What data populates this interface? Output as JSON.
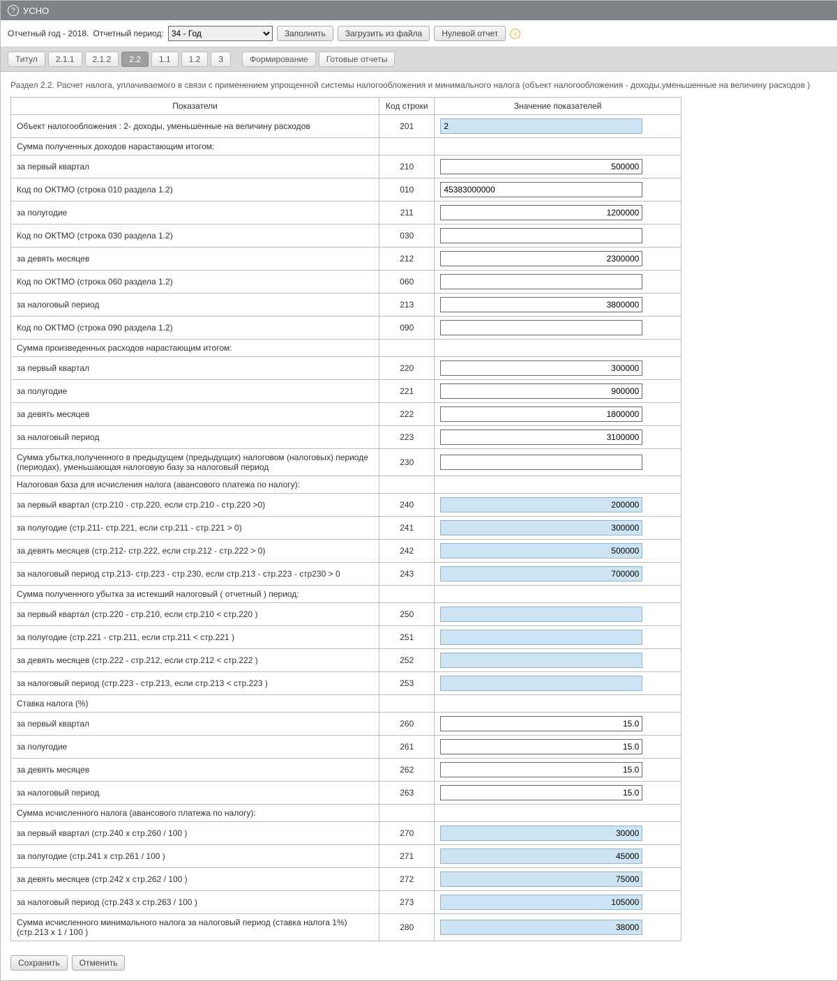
{
  "titlebar": {
    "title": "УСНО"
  },
  "toolbar": {
    "year_label": "Отчетный год - 2018.",
    "period_label": "Отчетный период:",
    "period_value": "34 - Год",
    "fill": "Заполнить",
    "load_file": "Загрузить из файла",
    "zero_report": "Нулевой отчет"
  },
  "tabs": {
    "titul": "Титул",
    "t211": "2.1.1",
    "t212": "2.1.2",
    "t22": "2.2",
    "t11": "1.1",
    "t12": "1.2",
    "t3": "3",
    "form": "Формирование",
    "ready": "Готовые отчеты"
  },
  "section_title": "Раздел 2.2. Расчет налога, уплачиваемого в связи с применением упрощенной системы налогообложения и минимального налога (объект налогообложения - доходы,уменьшенные на величину расходов )",
  "headers": {
    "ind": "Показатели",
    "code": "Код строки",
    "val": "Значение показателей"
  },
  "rows": [
    {
      "label": "Объект налогообложения : 2- доходы, уменьшенные на величину расходов",
      "code": "201",
      "value": "2",
      "align": "left",
      "readonly": true
    },
    {
      "label": "Сумма полученных доходов нарастающим итогом:",
      "code": "",
      "value": null
    },
    {
      "label": "за первый квартал",
      "code": "210",
      "value": "500000",
      "align": "right",
      "readonly": false
    },
    {
      "label": "Код по ОКТМО (строка 010 раздела 1.2)",
      "code": "010",
      "value": "45383000000",
      "align": "left",
      "readonly": false
    },
    {
      "label": "за полугодие",
      "code": "211",
      "value": "1200000",
      "align": "right",
      "readonly": false
    },
    {
      "label": "Код по ОКТМО (строка 030 раздела 1.2)",
      "code": "030",
      "value": "",
      "align": "left",
      "readonly": false
    },
    {
      "label": "за девять месяцев",
      "code": "212",
      "value": "2300000",
      "align": "right",
      "readonly": false
    },
    {
      "label": "Код по ОКТМО (строка 060 раздела 1.2)",
      "code": "060",
      "value": "",
      "align": "left",
      "readonly": false
    },
    {
      "label": "за налоговый период",
      "code": "213",
      "value": "3800000",
      "align": "right",
      "readonly": false
    },
    {
      "label": "Код по ОКТМО (строка 090 раздела 1.2)",
      "code": "090",
      "value": "",
      "align": "left",
      "readonly": false
    },
    {
      "label": "Сумма произведенных расходов нарастающим итогом:",
      "code": "",
      "value": null
    },
    {
      "label": "за первый квартал",
      "code": "220",
      "value": "300000",
      "align": "right",
      "readonly": false
    },
    {
      "label": "за полугодие",
      "code": "221",
      "value": "900000",
      "align": "right",
      "readonly": false
    },
    {
      "label": "за девять месяцев",
      "code": "222",
      "value": "1800000",
      "align": "right",
      "readonly": false
    },
    {
      "label": "за налоговый период",
      "code": "223",
      "value": "3100000",
      "align": "right",
      "readonly": false
    },
    {
      "label": "Сумма убытка,полученного в предыдущем (предыдущих) налоговом (налоговых) периоде (периодах), уменьшающая налоговую базу за налоговый период",
      "code": "230",
      "value": "",
      "align": "left",
      "readonly": false
    },
    {
      "label": "Налоговая база для исчисления налога (авансового платежа по налогу):",
      "code": "",
      "value": null
    },
    {
      "label": "за первый квартал (стр.210 - стр.220, если стр.210 - стр.220 >0)",
      "code": "240",
      "value": "200000",
      "align": "right",
      "readonly": true
    },
    {
      "label": "за полугодие (стр.211- стр.221, если стр.211 - стр.221 > 0)",
      "code": "241",
      "value": "300000",
      "align": "right",
      "readonly": true
    },
    {
      "label": "за девять месяцев (стр.212- стр.222, если стр.212 - стр.222 > 0)",
      "code": "242",
      "value": "500000",
      "align": "right",
      "readonly": true
    },
    {
      "label": "за налоговый период стр.213- стр.223 - стр.230, если стр.213 - стр.223 - стр230 > 0",
      "code": "243",
      "value": "700000",
      "align": "right",
      "readonly": true
    },
    {
      "label": "Сумма полученного убытка за истекший налоговый ( отчетный ) период:",
      "code": "",
      "value": null
    },
    {
      "label": "за первый квартал (стр.220 - стр.210, если стр.210 < стр.220 )",
      "code": "250",
      "value": "",
      "align": "right",
      "readonly": true
    },
    {
      "label": "за полугодие (стр.221 - стр.211, если стр.211 < стр.221 )",
      "code": "251",
      "value": "",
      "align": "right",
      "readonly": true
    },
    {
      "label": "за девять месяцев (стр.222 - стр.212, если стр.212 < стр.222 )",
      "code": "252",
      "value": "",
      "align": "right",
      "readonly": true
    },
    {
      "label": "за налоговый период (стр.223 - стр.213, если стр.213 < стр.223 )",
      "code": "253",
      "value": "",
      "align": "right",
      "readonly": true
    },
    {
      "label": "Ставка налога (%)",
      "code": "",
      "value": null
    },
    {
      "label": "за первый квартал",
      "code": "260",
      "value": "15.0",
      "align": "right",
      "readonly": false
    },
    {
      "label": "за полугодие",
      "code": "261",
      "value": "15.0",
      "align": "right",
      "readonly": false
    },
    {
      "label": "за девять месяцев",
      "code": "262",
      "value": "15.0",
      "align": "right",
      "readonly": false
    },
    {
      "label": "за налоговый период",
      "code": "263",
      "value": "15.0",
      "align": "right",
      "readonly": false
    },
    {
      "label": "Сумма исчисленного налога (авансового платежа по налогу):",
      "code": "",
      "value": null
    },
    {
      "label": "за первый квартал (стр.240 x стр.260 / 100 )",
      "code": "270",
      "value": "30000",
      "align": "right",
      "readonly": true
    },
    {
      "label": "за полугодие (стр.241 x стр.261 / 100 )",
      "code": "271",
      "value": "45000",
      "align": "right",
      "readonly": true
    },
    {
      "label": "за девять месяцев (стр.242 x стр.262 / 100 )",
      "code": "272",
      "value": "75000",
      "align": "right",
      "readonly": true
    },
    {
      "label": "за налоговый период (стр.243 x стр.263 / 100 )",
      "code": "273",
      "value": "105000",
      "align": "right",
      "readonly": true
    },
    {
      "label": "Сумма исчисленного минимального налога за налоговый период (ставка налога 1%) (стр.213 x 1 / 100 )",
      "code": "280",
      "value": "38000",
      "align": "right",
      "readonly": true
    }
  ],
  "footer": {
    "save": "Сохранить",
    "cancel": "Отменить"
  }
}
